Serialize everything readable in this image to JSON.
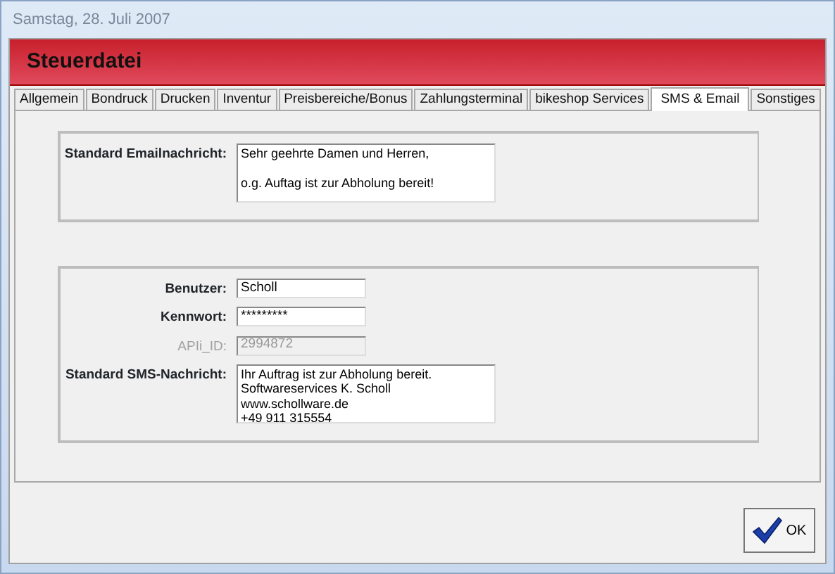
{
  "window": {
    "title": "Samstag, 28. Juli 2007"
  },
  "header": {
    "title": "Steuerdatei"
  },
  "tabs": [
    {
      "label": "Allgemein",
      "selected": false
    },
    {
      "label": "Bondruck",
      "selected": false
    },
    {
      "label": "Drucken",
      "selected": false
    },
    {
      "label": "Inventur",
      "selected": false
    },
    {
      "label": "Preisbereiche/Bonus",
      "selected": false
    },
    {
      "label": "Zahlungsterminal",
      "selected": false
    },
    {
      "label": "bikeshop Services",
      "selected": false
    },
    {
      "label": "SMS & Email",
      "selected": true
    },
    {
      "label": "Sonstiges",
      "selected": false
    }
  ],
  "email_group": {
    "fields": [
      {
        "label": "Standard Emailnachricht:",
        "kind": "multiline",
        "disabled": false,
        "paragraphs": [
          [
            "Sehr geehrte Damen und Herren,"
          ],
          [
            "o.g. Auftag ist zur Abholung bereit!"
          ]
        ]
      }
    ]
  },
  "sms_group": {
    "fields": [
      {
        "label": "Benutzer:",
        "kind": "text",
        "disabled": false,
        "value": "Scholl"
      },
      {
        "label": "Kennwort:",
        "kind": "text",
        "disabled": false,
        "value": "*********"
      },
      {
        "label": "APIi_ID:",
        "kind": "text",
        "disabled": true,
        "value": "2994872"
      },
      {
        "label": "Standard SMS-Nachricht:",
        "kind": "multiline",
        "disabled": false,
        "paragraphs": [
          [
            "Ihr Auftrag ist zur Abholung bereit.",
            "Softwareservices K. Scholl",
            "www.schollware.de",
            "+49 911 315554"
          ]
        ]
      }
    ]
  },
  "buttons": [
    {
      "label": "OK"
    }
  ]
}
